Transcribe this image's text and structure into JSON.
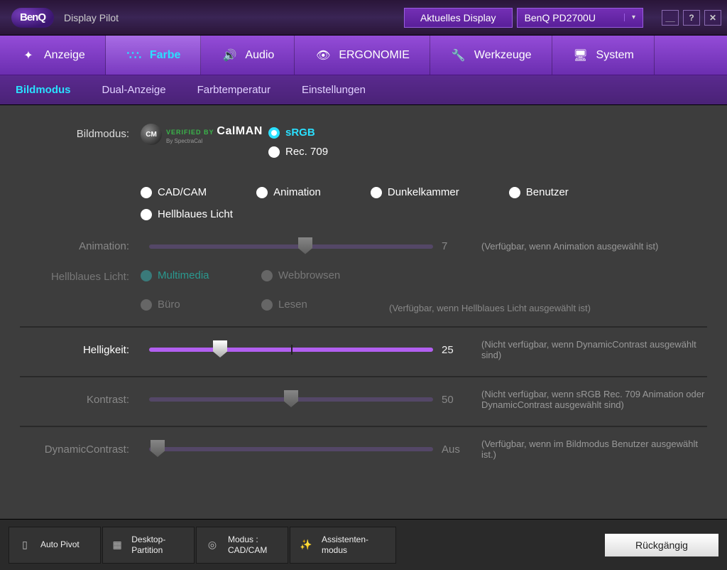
{
  "app": {
    "brand": "BenQ",
    "title": "Display Pilot"
  },
  "header": {
    "display_label": "Aktuelles Display",
    "display_value": "BenQ PD2700U"
  },
  "tabs": {
    "main": [
      {
        "label": "Anzeige"
      },
      {
        "label": "Farbe"
      },
      {
        "label": "Audio"
      },
      {
        "label": "ERGONOMIE"
      },
      {
        "label": "Werkzeuge"
      },
      {
        "label": "System"
      }
    ],
    "sub": [
      {
        "label": "Bildmodus"
      },
      {
        "label": "Dual-Anzeige"
      },
      {
        "label": "Farbtemperatur"
      },
      {
        "label": "Einstellungen"
      }
    ]
  },
  "bildmodus": {
    "label": "Bildmodus:",
    "calman": {
      "verified": "VERIFIED BY",
      "name": "CalMAN",
      "by": "By SpectraCal"
    },
    "presets": {
      "srgb": "sRGB",
      "rec709": "Rec. 709",
      "cadcam": "CAD/CAM",
      "animation": "Animation",
      "dunkelkammer": "Dunkelkammer",
      "benutzer": "Benutzer",
      "hellblaues": "Hellblaues Licht"
    }
  },
  "animation": {
    "label": "Animation:",
    "value": "7",
    "hint": "(Verfügbar, wenn Animation ausgewählt ist)"
  },
  "hbl": {
    "label": "Hellblaues Licht:",
    "options": {
      "multimedia": "Multimedia",
      "web": "Webbrowsen",
      "buero": "Büro",
      "lesen": "Lesen"
    },
    "hint": "(Verfügbar, wenn Hellblaues Licht ausgewählt ist)"
  },
  "sliders": {
    "helligkeit": {
      "label": "Helligkeit:",
      "value": "25",
      "hint": "(Nicht verfügbar, wenn DynamicContrast ausgewählt sind)"
    },
    "kontrast": {
      "label": "Kontrast:",
      "value": "50",
      "hint": "(Nicht verfügbar, wenn sRGB Rec. 709 Animation oder DynamicContrast ausgewählt sind)"
    },
    "dyn": {
      "label": "DynamicContrast:",
      "value": "Aus",
      "hint": "(Verfügbar, wenn im Bildmodus Benutzer ausgewählt ist.)"
    }
  },
  "bottom": {
    "autopivot": "Auto Pivot",
    "partition": "Desktop-Partition",
    "modus_l1": "Modus :",
    "modus_l2": "CAD/CAM",
    "assist_l1": "Assistenten-",
    "assist_l2": "modus",
    "undo": "Rückgängig"
  }
}
